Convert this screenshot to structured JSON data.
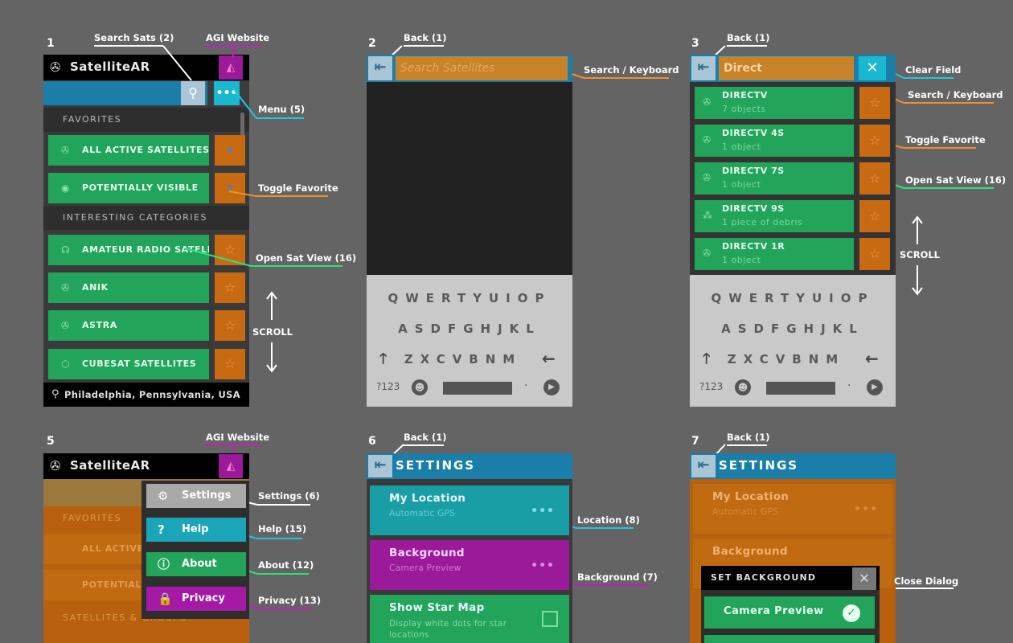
{
  "panel_numbers": [
    "1",
    "2",
    "3",
    "5",
    "6",
    "7"
  ],
  "annotations": {
    "search_sats": "Search Sats (2)",
    "agi_website": "AGI Website",
    "menu": "Menu (5)",
    "toggle_favorite": "Toggle Favorite",
    "open_sat_view": "Open Sat View (16)",
    "scroll": "SCROLL",
    "back": "Back (1)",
    "search_keyboard": "Search / Keyboard",
    "clear_field": "Clear Field",
    "settings": "Settings (6)",
    "help": "Help (15)",
    "about": "About (12)",
    "privacy": "Privacy (13)",
    "location": "Location (8)",
    "background": "Background (7)",
    "close_dialog": "Close Dialog"
  },
  "app": {
    "title": "SatelliteAR",
    "favorites_header": "FAVORITES",
    "categories_header": "INTERESTING CATEGORIES",
    "favorites": [
      "ALL ACTIVE SATELLITES",
      "POTENTIALLY VISIBLE"
    ],
    "categories": [
      "AMATEUR RADIO SATELLITES",
      "ANIK",
      "ASTRA",
      "CUBESAT SATELLITES"
    ],
    "location": "Philadelphia, Pennsylvania, USA"
  },
  "search": {
    "placeholder": "Search Satellites",
    "typed": "Direct",
    "results": [
      {
        "title": "DIRECTV",
        "sub": "7 objects"
      },
      {
        "title": "DIRECTV 4S",
        "sub": "1 object"
      },
      {
        "title": "DIRECTV 7S",
        "sub": "1 object"
      },
      {
        "title": "DIRECTV 9S",
        "sub": "1 piece of debris"
      },
      {
        "title": "DIRECTV 1R",
        "sub": "1 object"
      }
    ]
  },
  "keyboard": {
    "row1": "QWERTYUIOP",
    "row2": "ASDFGHJKL",
    "row3": "ZXCVBNM",
    "sym": "?123",
    "period": "·"
  },
  "menu": {
    "items": [
      "Settings",
      "Help",
      "About",
      "Privacy"
    ],
    "bg_favorites": "FAVORITES",
    "bg_all_active": "ALL ACTIVE",
    "bg_potentially": "POTENTIALL",
    "bg_groups": "SATELLITES & GROUPS"
  },
  "settings": {
    "title": "SETTINGS",
    "my_location": "My Location",
    "my_location_sub": "Automatic GPS",
    "background": "Background",
    "background_sub": "Camera Preview",
    "star_map": "Show Star Map",
    "star_map_sub": "Display white dots for star locations",
    "dots": "•••",
    "dialog_title": "SET BACKGROUND",
    "dialog_option": "Camera Preview"
  },
  "colors": {
    "magenta": "#c21ec2",
    "cyan": "#21c6e2",
    "orange": "#f0902a",
    "green": "#2fe07a",
    "row_green": "#22a45a",
    "star_orange": "#c86a12"
  }
}
